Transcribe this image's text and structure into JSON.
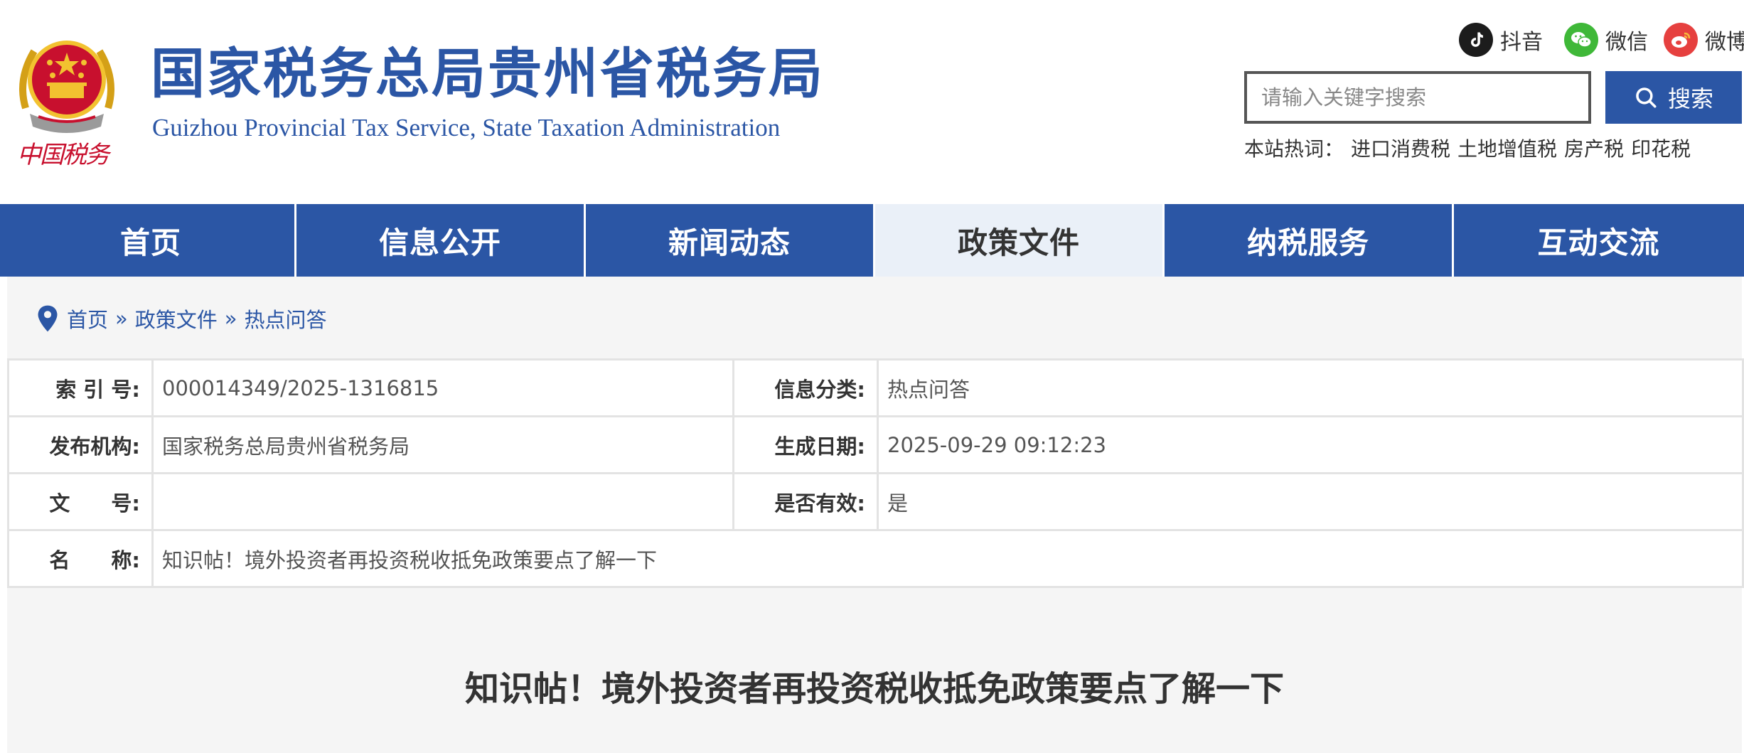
{
  "header": {
    "site_title_cn": "国家税务总局贵州省税务局",
    "site_title_en": "Guizhou Provincial Tax Service, State Taxation Administration",
    "emblem_caption": "中国税务"
  },
  "social": {
    "douyin": "抖音",
    "wechat": "微信",
    "weibo": "微博"
  },
  "search": {
    "placeholder": "请输入关键字搜索",
    "button_label": "搜索"
  },
  "hotwords": {
    "label": "本站热词：",
    "items": [
      "进口消费税",
      "土地增值税",
      "房产税",
      "印花税"
    ]
  },
  "nav": {
    "items": [
      "首页",
      "信息公开",
      "新闻动态",
      "政策文件",
      "纳税服务",
      "互动交流"
    ],
    "active": "政策文件"
  },
  "breadcrumb": {
    "items": [
      "首页",
      "政策文件",
      "热点问答"
    ],
    "separator": "»"
  },
  "meta": {
    "index_label": "索 引 号:",
    "index_value": "000014349/2025-1316815",
    "category_label": "信息分类:",
    "category_value": "热点问答",
    "publisher_label": "发布机构:",
    "publisher_value": "国家税务总局贵州省税务局",
    "date_label": "生成日期:",
    "date_value": "2025-09-29 09:12:23",
    "docno_label": "文　　号:",
    "docno_value": "",
    "valid_label": "是否有效:",
    "valid_value": "是",
    "name_label": "名　　称:",
    "name_value": "知识帖！境外投资者再投资税收抵免政策要点了解一下"
  },
  "article": {
    "title": "知识帖！境外投资者再投资税收抵免政策要点了解一下"
  },
  "colors": {
    "brand_blue": "#2b56a5",
    "nav_active_bg": "#eaf0f8",
    "content_bg": "#f5f5f5",
    "emblem_red": "#c8102e",
    "emblem_gold": "#f2c230"
  }
}
